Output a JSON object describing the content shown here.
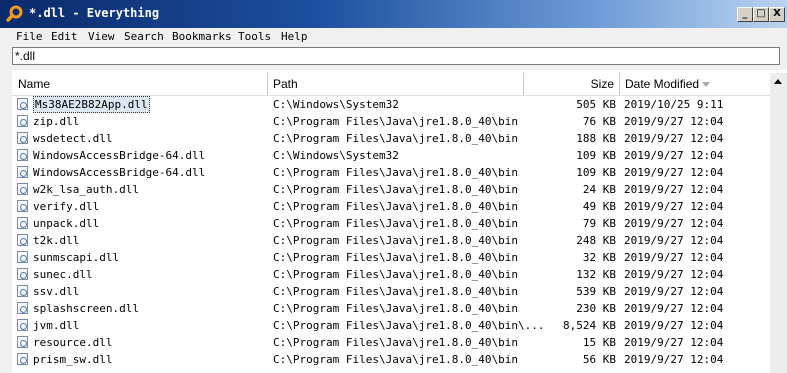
{
  "window": {
    "title": "*.dll - Everything",
    "icon": "magnifier-icon"
  },
  "window_buttons": {
    "minimize": "_",
    "maximize": "□",
    "close": "X"
  },
  "menu": [
    "File",
    "Edit",
    "View",
    "Search",
    "Bookmarks",
    "Tools",
    "Help"
  ],
  "search": {
    "value": "*.dll"
  },
  "columns": {
    "name": "Name",
    "path": "Path",
    "size": "Size",
    "date": "Date Modified"
  },
  "rows": [
    {
      "name": "Ms38AE2B82App.dll",
      "path": "C:\\Windows\\System32",
      "size": "505 KB",
      "date": "2019/10/25 9:11",
      "selected": true
    },
    {
      "name": "zip.dll",
      "path": "C:\\Program Files\\Java\\jre1.8.0_40\\bin",
      "size": "76 KB",
      "date": "2019/9/27 12:04"
    },
    {
      "name": "wsdetect.dll",
      "path": "C:\\Program Files\\Java\\jre1.8.0_40\\bin",
      "size": "188 KB",
      "date": "2019/9/27 12:04"
    },
    {
      "name": "WindowsAccessBridge-64.dll",
      "path": "C:\\Windows\\System32",
      "size": "109 KB",
      "date": "2019/9/27 12:04"
    },
    {
      "name": "WindowsAccessBridge-64.dll",
      "path": "C:\\Program Files\\Java\\jre1.8.0_40\\bin",
      "size": "109 KB",
      "date": "2019/9/27 12:04"
    },
    {
      "name": "w2k_lsa_auth.dll",
      "path": "C:\\Program Files\\Java\\jre1.8.0_40\\bin",
      "size": "24 KB",
      "date": "2019/9/27 12:04"
    },
    {
      "name": "verify.dll",
      "path": "C:\\Program Files\\Java\\jre1.8.0_40\\bin",
      "size": "49 KB",
      "date": "2019/9/27 12:04"
    },
    {
      "name": "unpack.dll",
      "path": "C:\\Program Files\\Java\\jre1.8.0_40\\bin",
      "size": "79 KB",
      "date": "2019/9/27 12:04"
    },
    {
      "name": "t2k.dll",
      "path": "C:\\Program Files\\Java\\jre1.8.0_40\\bin",
      "size": "248 KB",
      "date": "2019/9/27 12:04"
    },
    {
      "name": "sunmscapi.dll",
      "path": "C:\\Program Files\\Java\\jre1.8.0_40\\bin",
      "size": "32 KB",
      "date": "2019/9/27 12:04"
    },
    {
      "name": "sunec.dll",
      "path": "C:\\Program Files\\Java\\jre1.8.0_40\\bin",
      "size": "132 KB",
      "date": "2019/9/27 12:04"
    },
    {
      "name": "ssv.dll",
      "path": "C:\\Program Files\\Java\\jre1.8.0_40\\bin",
      "size": "539 KB",
      "date": "2019/9/27 12:04"
    },
    {
      "name": "splashscreen.dll",
      "path": "C:\\Program Files\\Java\\jre1.8.0_40\\bin",
      "size": "230 KB",
      "date": "2019/9/27 12:04"
    },
    {
      "name": "jvm.dll",
      "path": "C:\\Program Files\\Java\\jre1.8.0_40\\bin\\...",
      "size": "8,524 KB",
      "date": "2019/9/27 12:04"
    },
    {
      "name": "resource.dll",
      "path": "C:\\Program Files\\Java\\jre1.8.0_40\\bin",
      "size": "15 KB",
      "date": "2019/9/27 12:04"
    },
    {
      "name": "prism_sw.dll",
      "path": "C:\\Program Files\\Java\\jre1.8.0_40\\bin",
      "size": "56 KB",
      "date": "2019/9/27 12:04"
    }
  ],
  "colors": {
    "title_start": "#0a2a6b",
    "title_end": "#b9d3ee",
    "selection": "#dde6f3",
    "chrome": "#f0f0f0"
  }
}
